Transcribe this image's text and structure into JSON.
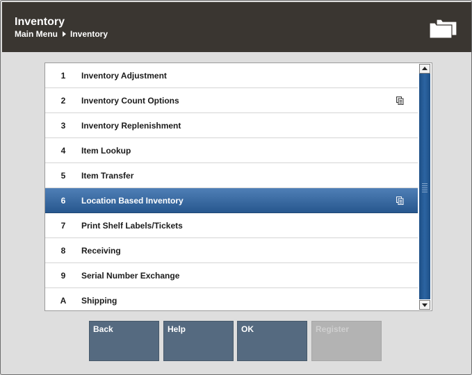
{
  "header": {
    "title": "Inventory",
    "breadcrumb": [
      "Main Menu",
      "Inventory"
    ]
  },
  "menu": {
    "items": [
      {
        "key": "1",
        "label": "Inventory Adjustment",
        "has_submenu": false,
        "selected": false
      },
      {
        "key": "2",
        "label": "Inventory Count Options",
        "has_submenu": true,
        "selected": false
      },
      {
        "key": "3",
        "label": "Inventory Replenishment",
        "has_submenu": false,
        "selected": false
      },
      {
        "key": "4",
        "label": "Item Lookup",
        "has_submenu": false,
        "selected": false
      },
      {
        "key": "5",
        "label": "Item Transfer",
        "has_submenu": false,
        "selected": false
      },
      {
        "key": "6",
        "label": "Location Based Inventory",
        "has_submenu": true,
        "selected": true
      },
      {
        "key": "7",
        "label": "Print Shelf Labels/Tickets",
        "has_submenu": false,
        "selected": false
      },
      {
        "key": "8",
        "label": "Receiving",
        "has_submenu": false,
        "selected": false
      },
      {
        "key": "9",
        "label": "Serial Number Exchange",
        "has_submenu": false,
        "selected": false
      },
      {
        "key": "A",
        "label": "Shipping",
        "has_submenu": false,
        "selected": false
      }
    ]
  },
  "buttons": [
    {
      "label": "Back",
      "enabled": true
    },
    {
      "label": "Help",
      "enabled": true
    },
    {
      "label": "OK",
      "enabled": true
    },
    {
      "label": "Register",
      "enabled": false
    }
  ],
  "colors": {
    "header_bg": "#3a3631",
    "selection": "#2f5f97",
    "button_bg": "#556a80",
    "button_disabled": "#b3b3b3"
  },
  "icons": {
    "header": "folders-icon",
    "submenu": "submenu-icon"
  }
}
